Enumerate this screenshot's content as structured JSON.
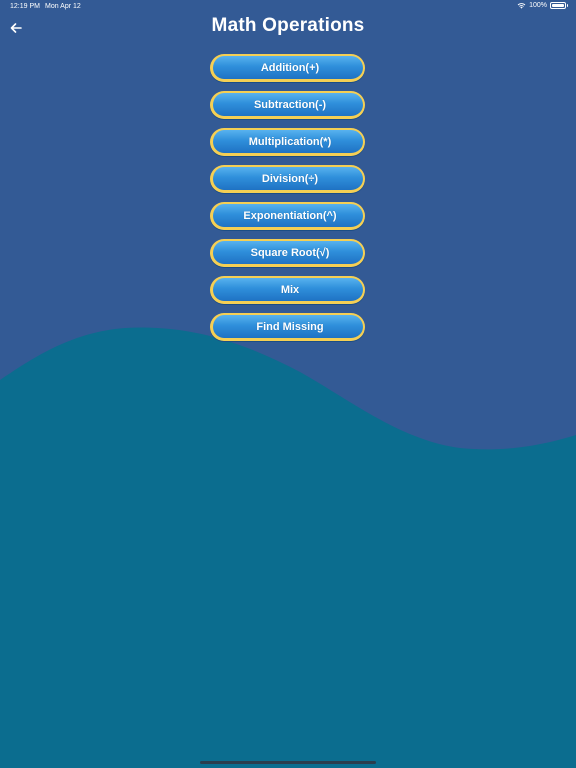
{
  "status_bar": {
    "time": "12:19 PM",
    "date": "Mon Apr 12",
    "battery": "100%",
    "battery_level": 1.0
  },
  "header": {
    "back_icon": "arrow-left-icon",
    "title": "Math Operations"
  },
  "operations": [
    {
      "label": "Addition(+)"
    },
    {
      "label": "Subtraction(-)"
    },
    {
      "label": "Multiplication(*)"
    },
    {
      "label": "Division(÷)"
    },
    {
      "label": "Exponentiation(^)"
    },
    {
      "label": "Square Root(√)"
    },
    {
      "label": "Mix"
    },
    {
      "label": "Find Missing"
    }
  ],
  "colors": {
    "background": "#335a95",
    "wave": "#0b6d8f",
    "button_fill": "#2f8fdb",
    "button_border": "#f5cf54",
    "text": "#ffffff"
  }
}
